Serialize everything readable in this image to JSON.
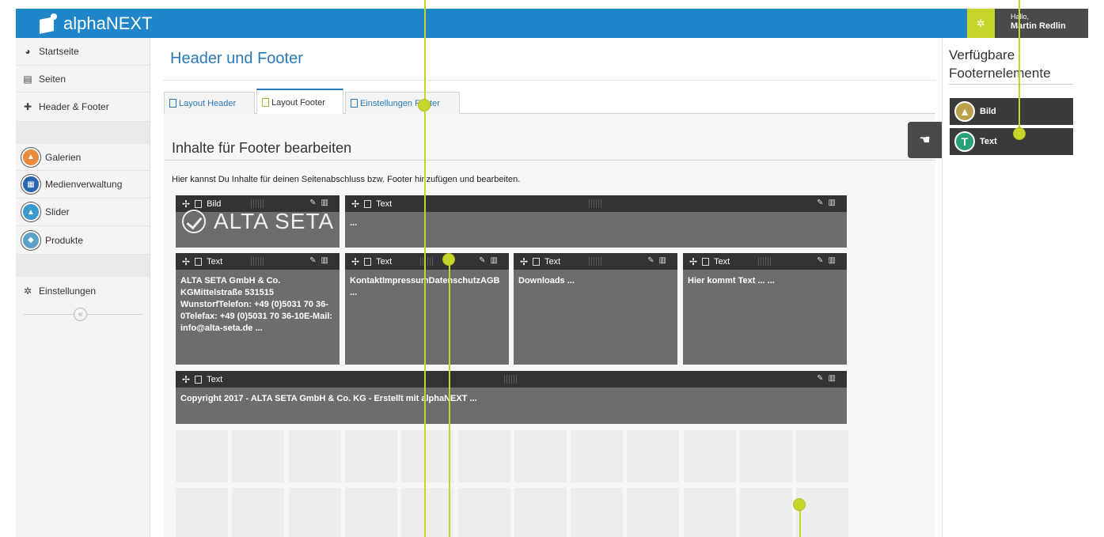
{
  "app": {
    "name": "alphaNEXT"
  },
  "user": {
    "greeting": "Hallo,",
    "name": "Martin Redlin"
  },
  "sidebar": {
    "items": [
      {
        "label": "Startseite",
        "icon": "dashboard-icon"
      },
      {
        "label": "Seiten",
        "icon": "page-icon"
      },
      {
        "label": "Header & Footer",
        "icon": "puzzle-icon"
      },
      {
        "label": "Galerien",
        "icon": "gallery-icon",
        "color": "#e98a3a"
      },
      {
        "label": "Medienverwaltung",
        "icon": "media-grid-icon",
        "color": "#2a66b0"
      },
      {
        "label": "Slider",
        "icon": "slider-icon",
        "color": "#3a9ad0"
      },
      {
        "label": "Produkte",
        "icon": "product-box-icon",
        "color": "#5aa0c8"
      },
      {
        "label": "Einstellungen",
        "icon": "gear-icon"
      }
    ]
  },
  "page": {
    "title": "Header und Footer"
  },
  "tabs": [
    {
      "label": "Layout Header",
      "active": false
    },
    {
      "label": "Layout Footer",
      "active": true
    },
    {
      "label": "Einstellungen Footer",
      "active": false
    }
  ],
  "section": {
    "title": "Inhalte für Footer bearbeiten",
    "hint": "Hier kannst Du Inhalte für deinen Seitenabschluss bzw. Footer hinzufügen und bearbeiten."
  },
  "blocks": {
    "row1": [
      {
        "type": "Bild",
        "logo_text": "ALTA SETA"
      },
      {
        "type": "Text",
        "content": "..."
      }
    ],
    "row2": [
      {
        "type": "Text",
        "content": "ALTA SETA GmbH & Co. KGMittelstraße 531515 WunstorfTelefon:   +49 (0)5031 70 36-0Telefax:   +49 (0)5031 70 36-10E-Mail:   info@alta-seta.de ..."
      },
      {
        "type": "Text",
        "content": "KontaktImpressumDatenschutzAGB ..."
      },
      {
        "type": "Text",
        "content": "Downloads ..."
      },
      {
        "type": "Text",
        "content": "Hier kommt Text ... ..."
      }
    ],
    "row3": [
      {
        "type": "Text",
        "content": "Copyright 2017 - ALTA SETA GmbH & Co. KG - Erstellt mit alphaNEXT ..."
      }
    ]
  },
  "right_panel": {
    "title": "Verfügbare Footernelemente",
    "elements": [
      {
        "label": "Bild",
        "icon": "image-icon",
        "color": "#b9a24a"
      },
      {
        "label": "Text",
        "icon": "text-t-icon",
        "color": "#2aa07a"
      }
    ]
  },
  "colors": {
    "topbar": "#1f87c9",
    "accent": "#c6d52a",
    "block": "#6d6d6d",
    "block_header": "#333333"
  }
}
